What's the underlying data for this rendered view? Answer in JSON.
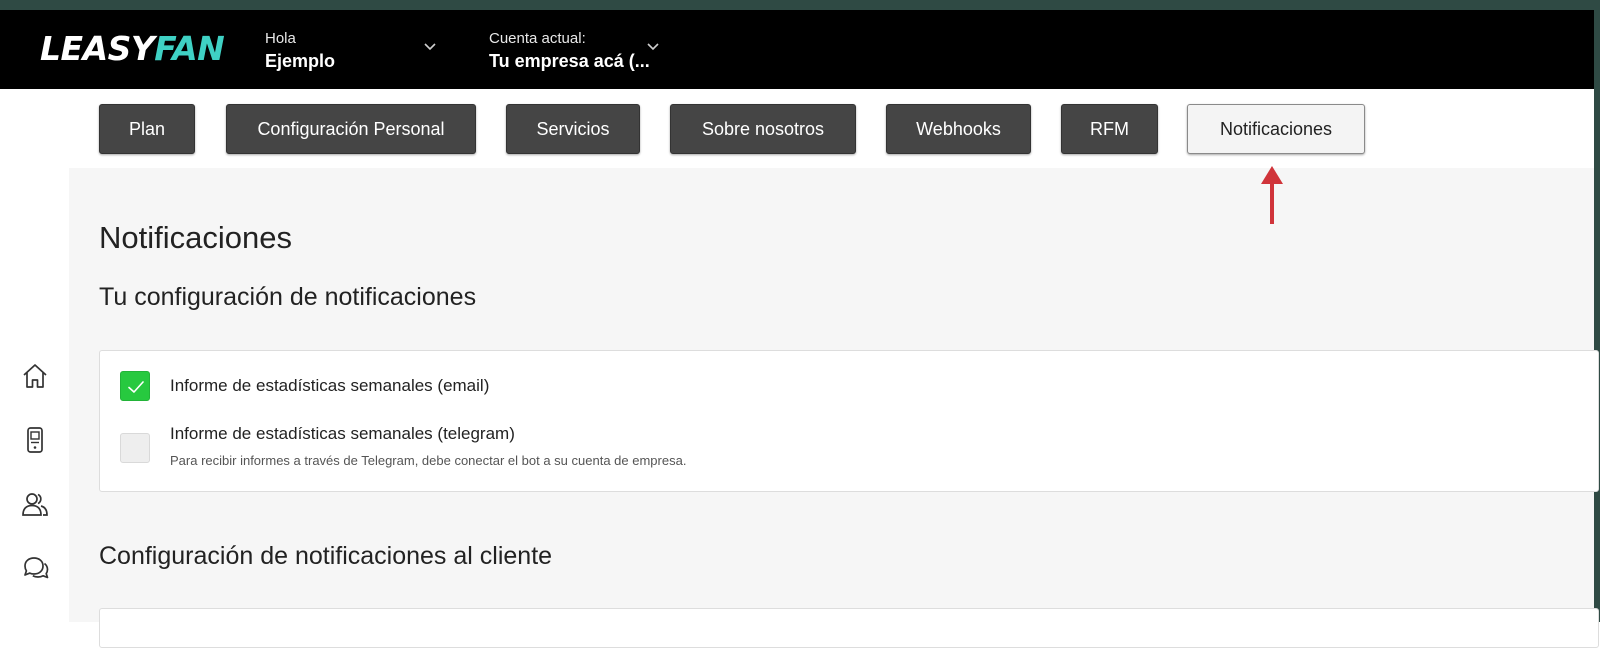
{
  "brand": {
    "logo_part1": "LEASY",
    "logo_part2": "FAN",
    "accent_color": "#3fd1c4"
  },
  "header": {
    "greeting_label": "Hola",
    "user_name": "Ejemplo",
    "account_label": "Cuenta actual:",
    "account_name": "Tu empresa acá (..."
  },
  "tabs": [
    {
      "label": "Plan",
      "active": false
    },
    {
      "label": "Configuración Personal",
      "active": false
    },
    {
      "label": "Servicios",
      "active": false
    },
    {
      "label": "Sobre nosotros",
      "active": false
    },
    {
      "label": "Webhooks",
      "active": false
    },
    {
      "label": "RFM",
      "active": false
    },
    {
      "label": "Notificaciones",
      "active": true
    }
  ],
  "sidebar": {
    "icons": [
      "home-icon",
      "mobile-device-icon",
      "users-icon",
      "chat-icon"
    ]
  },
  "main": {
    "page_title": "Notificaciones",
    "section1_title": "Tu configuración de notificaciones",
    "options": [
      {
        "label": "Informe de estadísticas semanales (email)",
        "checked": true
      },
      {
        "label": "Informe de estadísticas semanales (telegram)",
        "checked": false,
        "help": "Para recibir informes a través de Telegram, debe conectar el bot a su cuenta de empresa."
      }
    ],
    "section2_title": "Configuración de notificaciones al cliente"
  },
  "colors": {
    "checkbox_checked": "#27c93f",
    "tab_bg": "#454545",
    "annotation_arrow": "#d0343a"
  }
}
